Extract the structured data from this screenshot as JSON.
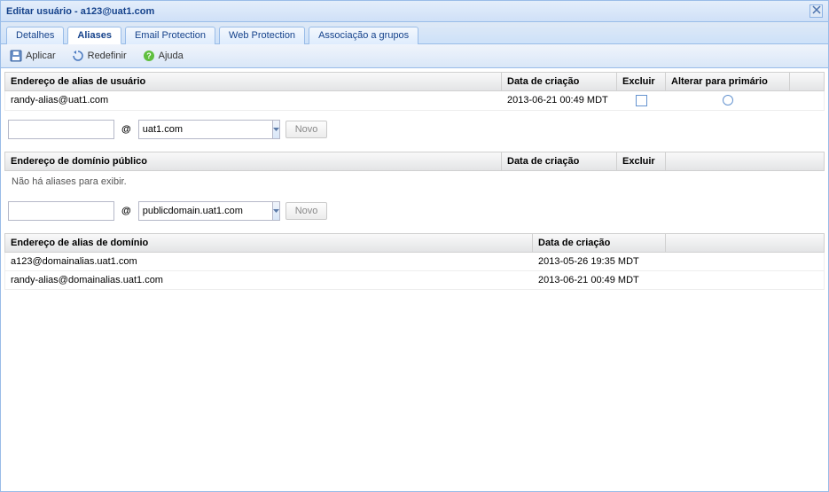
{
  "window": {
    "title": "Editar usuário - a123@uat1.com"
  },
  "tabs": [
    {
      "label": "Detalhes"
    },
    {
      "label": "Aliases"
    },
    {
      "label": "Email Protection"
    },
    {
      "label": "Web Protection"
    },
    {
      "label": "Associação a grupos"
    }
  ],
  "toolbar": {
    "apply": "Aplicar",
    "reset": "Redefinir",
    "help": "Ajuda"
  },
  "userAlias": {
    "headers": {
      "address": "Endereço de alias de usuário",
      "created": "Data de criação",
      "delete": "Excluir",
      "primary": "Alterar para primário"
    },
    "rows": [
      {
        "address": "randy-alias@uat1.com",
        "created": "2013-06-21 00:49 MDT"
      }
    ],
    "form": {
      "local": "",
      "domainSelected": "uat1.com",
      "newBtn": "Novo",
      "at": "@"
    }
  },
  "publicDomain": {
    "headers": {
      "address": "Endereço de domínio público",
      "created": "Data de criação",
      "delete": "Excluir"
    },
    "emptyMsg": "Não há aliases para exibir.",
    "form": {
      "local": "",
      "domainSelected": "publicdomain.uat1.com",
      "newBtn": "Novo",
      "at": "@"
    }
  },
  "domainAlias": {
    "headers": {
      "address": "Endereço de alias de domínio",
      "created": "Data de criação"
    },
    "rows": [
      {
        "address": "a123@domainalias.uat1.com",
        "created": "2013-05-26 19:35 MDT"
      },
      {
        "address": "randy-alias@domainalias.uat1.com",
        "created": "2013-06-21 00:49 MDT"
      }
    ]
  }
}
